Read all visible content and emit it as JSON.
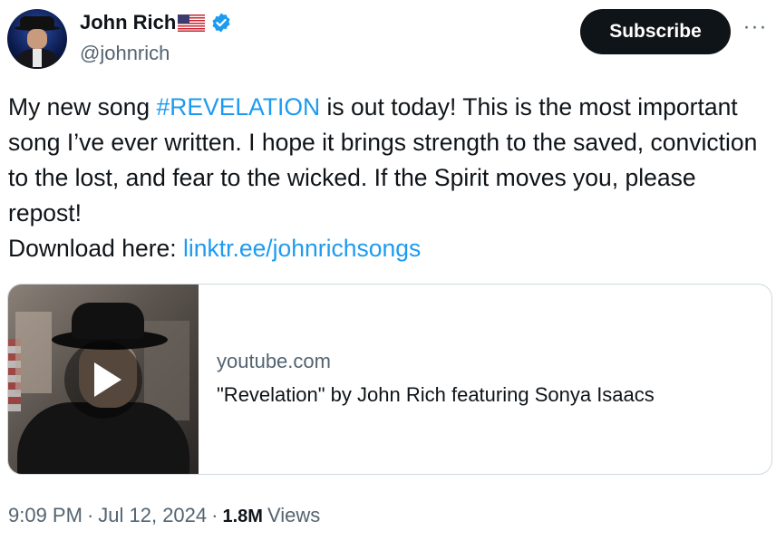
{
  "author": {
    "display_name": "John Rich",
    "flag_emoji": "🇺🇸",
    "handle": "@johnrich",
    "verified_color": "#1d9bf0"
  },
  "actions": {
    "subscribe_label": "Subscribe",
    "more_label": "···"
  },
  "tweet": {
    "text_before_hashtag": "My new song ",
    "hashtag": "#REVELATION",
    "text_after_hashtag": " is out today! This is the most important song I’ve ever written. I hope it brings strength to the saved, conviction to the lost, and fear to the wicked. If the Spirit moves you, please repost!\nDownload here: ",
    "link": "linktr.ee/johnrichsongs"
  },
  "card": {
    "domain": "youtube.com",
    "title": "\"Revelation\" by John Rich featuring Sonya Isaacs"
  },
  "meta": {
    "time": "9:09 PM",
    "separator": "·",
    "date": "Jul 12, 2024",
    "views_count": "1.8M",
    "views_label": "Views"
  },
  "colors": {
    "link": "#1d9bf0",
    "text": "#0f1419",
    "secondary": "#536471",
    "border": "#cfd9de"
  }
}
